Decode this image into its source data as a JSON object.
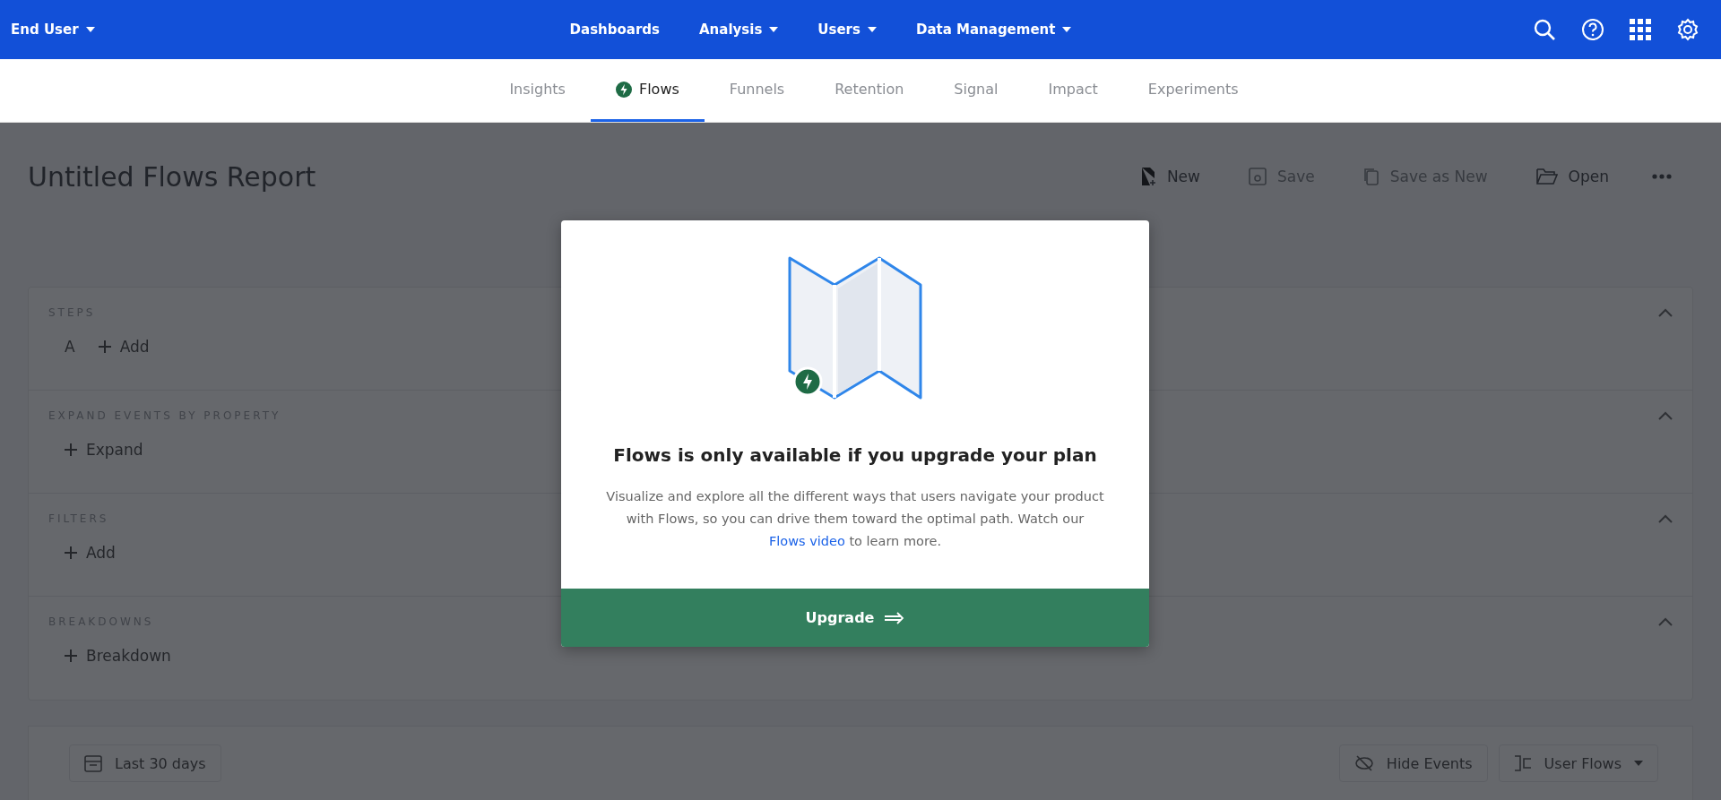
{
  "top_nav": {
    "account": {
      "label": "End User",
      "dropdown": true
    },
    "items": [
      {
        "label": "Dashboards",
        "dropdown": false
      },
      {
        "label": "Analysis",
        "dropdown": true
      },
      {
        "label": "Users",
        "dropdown": true
      },
      {
        "label": "Data Management",
        "dropdown": true
      }
    ]
  },
  "tabs": [
    {
      "label": "Insights",
      "selected": false
    },
    {
      "label": "Flows",
      "selected": true
    },
    {
      "label": "Funnels",
      "selected": false
    },
    {
      "label": "Retention",
      "selected": false
    },
    {
      "label": "Signal",
      "selected": false
    },
    {
      "label": "Impact",
      "selected": false
    },
    {
      "label": "Experiments",
      "selected": false
    }
  ],
  "report": {
    "title": "Untitled Flows Report",
    "toolbar": [
      {
        "label": "New",
        "kind": "new",
        "disabled": false
      },
      {
        "label": "Save",
        "kind": "save",
        "disabled": true
      },
      {
        "label": "Save as New",
        "kind": "copy",
        "disabled": true
      },
      {
        "label": "Open",
        "kind": "open",
        "disabled": false
      }
    ]
  },
  "sections": [
    {
      "label": "STEPS",
      "expanded": true,
      "items": [
        {
          "text": "A",
          "kind": "letter"
        },
        {
          "text": "Add",
          "kind": "add"
        }
      ]
    },
    {
      "label": "EXPAND EVENTS BY PROPERTY",
      "expanded": true,
      "items": [
        {
          "text": "Expand",
          "kind": "add"
        }
      ]
    },
    {
      "label": "FILTERS",
      "expanded": true,
      "items": [
        {
          "text": "Add",
          "kind": "add"
        }
      ]
    },
    {
      "label": "BREAKDOWNS",
      "expanded": true,
      "items": [
        {
          "text": "Breakdown",
          "kind": "add"
        }
      ]
    }
  ],
  "bottom_bar": {
    "date_range": "Last 30 days",
    "hide_events": "Hide Events",
    "view": "User Flows"
  },
  "modal": {
    "title": "Flows is only available if you upgrade your plan",
    "body": "Visualize and explore all the different ways that users navigate your product with Flows, so you can drive them toward the optimal path. Watch our ",
    "link": "Flows video",
    "body_end": " to learn more.",
    "button": "Upgrade"
  }
}
